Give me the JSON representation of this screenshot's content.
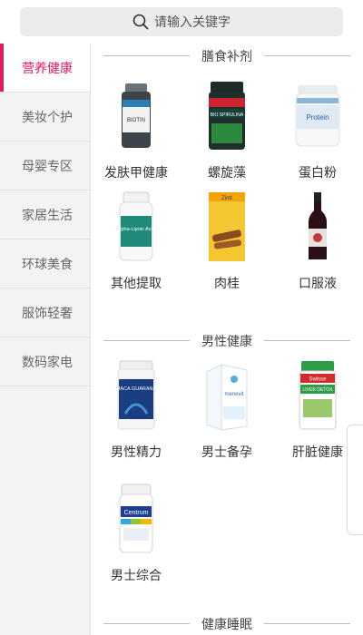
{
  "search": {
    "placeholder": "请输入关键字"
  },
  "sidebar": {
    "items": [
      {
        "label": "营养健康",
        "active": true
      },
      {
        "label": "美妆个护"
      },
      {
        "label": "母婴专区"
      },
      {
        "label": "家居生活"
      },
      {
        "label": "环球美食"
      },
      {
        "label": "服饰轻奢"
      },
      {
        "label": "数码家电"
      }
    ]
  },
  "sections": [
    {
      "title": "膳食补剂",
      "products": [
        {
          "name": "发肤甲健康",
          "icon": "biotin-bottle-icon"
        },
        {
          "name": "螺旋藻",
          "icon": "spirulina-bottle-icon"
        },
        {
          "name": "蛋白粉",
          "icon": "protein-tub-icon"
        },
        {
          "name": "其他提取",
          "icon": "lipoic-acid-bottle-icon"
        },
        {
          "name": "肉桂",
          "icon": "cinnamon-box-icon"
        },
        {
          "name": "口服液",
          "icon": "tonic-bottle-icon"
        }
      ]
    },
    {
      "title": "男性健康",
      "products": [
        {
          "name": "男性精力",
          "icon": "maca-guarana-bottle-icon"
        },
        {
          "name": "男士备孕",
          "icon": "menevit-box-icon"
        },
        {
          "name": "肝脏健康",
          "icon": "liver-detox-bottle-icon"
        },
        {
          "name": "男士综合",
          "icon": "centrum-bottle-icon"
        }
      ]
    },
    {
      "title": "健康睡眠",
      "products": []
    }
  ],
  "product_labels": {
    "biotin": "BIOTIN",
    "spirulina": "BIO SPIRULINA",
    "protein": "Protein",
    "lipoic": "alpha-Lipoic Acid",
    "cinnamon": "Zimt",
    "maca": "MACA GUARANA",
    "menevit": "menevit",
    "swisse": "Swisse",
    "liver": "LIVER DETOX",
    "centrum": "Centrum"
  },
  "colors": {
    "accent": "#e5195e"
  }
}
